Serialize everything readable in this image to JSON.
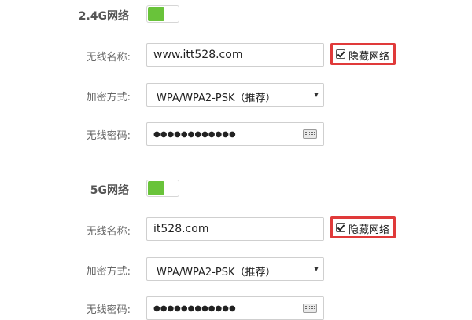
{
  "band24": {
    "title": "2.4G网络",
    "toggle_on": true,
    "ssid_label": "无线名称:",
    "ssid_value": "www.itt528.com",
    "hide_label": "隐藏网络",
    "hide_checked": true,
    "encryption_label": "加密方式:",
    "encryption_value": "WPA/WPA2-PSK（推荐）",
    "password_label": "无线密码:",
    "password_mask": "●●●●●●●●●●●●"
  },
  "band5": {
    "title": "5G网络",
    "toggle_on": true,
    "ssid_label": "无线名称:",
    "ssid_value": "it528.com",
    "hide_label": "隐藏网络",
    "hide_checked": true,
    "encryption_label": "加密方式:",
    "encryption_value": "WPA/WPA2-PSK（推荐）",
    "password_label": "无线密码:",
    "password_mask": "●●●●●●●●●●●●"
  },
  "colors": {
    "toggle_on": "#69c33a",
    "highlight_border": "#e03a3a"
  },
  "icons": [
    "checkbox-checked-icon",
    "dropdown-caret-icon",
    "keyboard-icon"
  ]
}
